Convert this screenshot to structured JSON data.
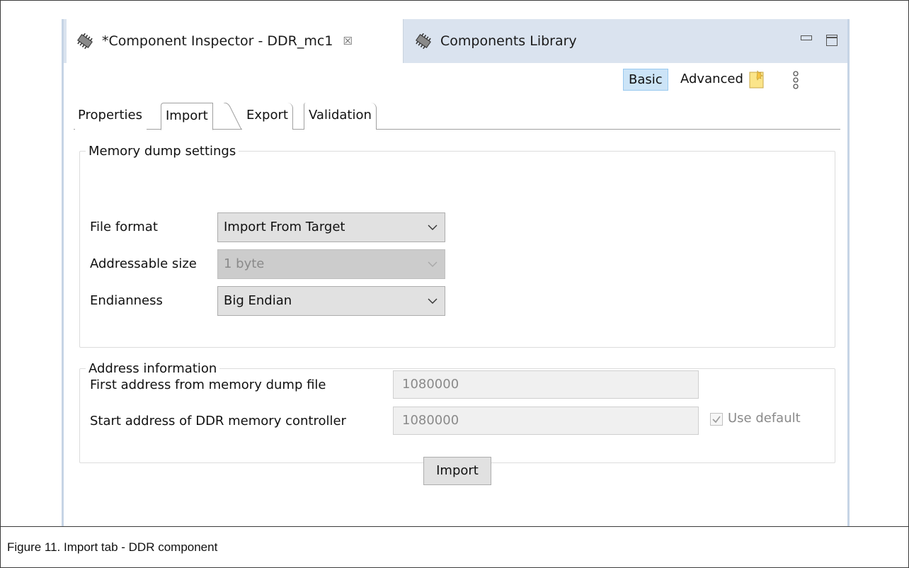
{
  "window": {
    "active_tab_label": "*Component Inspector - DDR_mc1",
    "active_tab_close": "☒",
    "inactive_tab_label": "Components Library"
  },
  "toolbar": {
    "basic_label": "Basic",
    "advanced_label": "Advanced"
  },
  "subtabs": {
    "properties": "Properties",
    "import": "Import",
    "export": "Export",
    "validation": "Validation"
  },
  "memory_dump": {
    "legend": "Memory dump settings",
    "file_format_label": "File format",
    "file_format_value": "Import From Target",
    "addressable_size_label": "Addressable size",
    "addressable_size_value": "1 byte",
    "endianness_label": "Endianness",
    "endianness_value": "Big Endian"
  },
  "address_info": {
    "legend": "Address information",
    "first_address_label": "First address from memory dump file",
    "first_address_value": "1080000",
    "start_address_label": "Start address of DDR memory controller",
    "start_address_value": "1080000",
    "use_default_label": "Use default",
    "use_default_checked": true
  },
  "import_button_label": "Import",
  "caption": "Figure 11. Import tab - DDR component",
  "colors": {
    "tabbar_bg": "#dae3ef",
    "basic_highlight": "#cce4f7",
    "combo_bg": "#e1e1e1",
    "disabled_bg": "#cccccc"
  }
}
